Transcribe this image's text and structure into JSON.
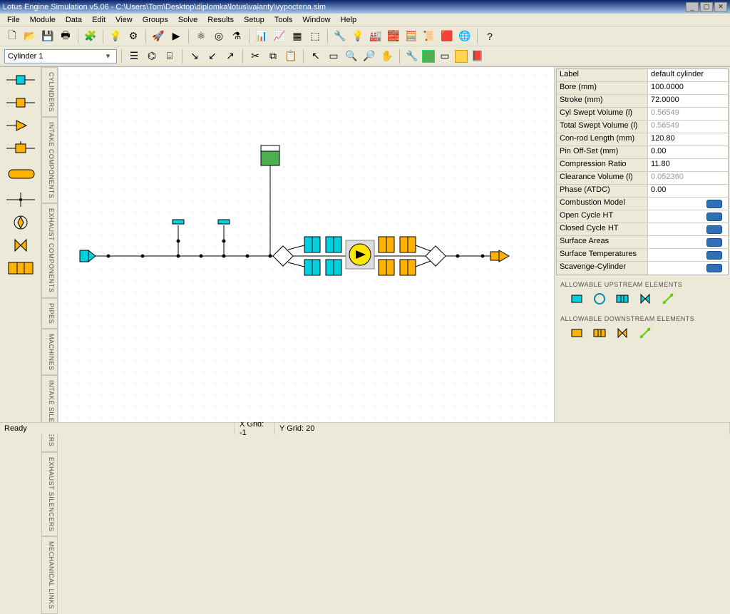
{
  "window": {
    "title": "Lotus Engine Simulation v5.06 - C:\\Users\\Tom\\Desktop\\diplomka\\lotus\\vaianty\\vypoctena.sim"
  },
  "menu": [
    "File",
    "Module",
    "Data",
    "Edit",
    "View",
    "Groups",
    "Solve",
    "Results",
    "Setup",
    "Tools",
    "Window",
    "Help"
  ],
  "combo": {
    "selected": "Cylinder 1"
  },
  "side_tabs": [
    "CYLINDERS",
    "INTAKE COMPONENTS",
    "EXHAUST COMPONENTS",
    "PIPES",
    "MACHINES",
    "INTAKE SILENCERS",
    "EXHAUST SILENCERS",
    "MECHANICAL LINKS"
  ],
  "status": {
    "ready": "Ready",
    "xgrid": "X Grid: -1",
    "ygrid": "Y Grid: 20"
  },
  "props": [
    {
      "label": "Label",
      "value": "default cylinder",
      "kind": "text"
    },
    {
      "label": "Bore (mm)",
      "value": "100.0000",
      "kind": "text"
    },
    {
      "label": "Stroke (mm)",
      "value": "72.0000",
      "kind": "text"
    },
    {
      "label": "Cyl Swept Volume (l)",
      "value": "0.56549",
      "kind": "ro"
    },
    {
      "label": "Total Swept Volume (l)",
      "value": "0.56549",
      "kind": "ro"
    },
    {
      "label": "Con-rod Length (mm)",
      "value": "120.80",
      "kind": "text"
    },
    {
      "label": "Pin Off-Set (mm)",
      "value": "0.00",
      "kind": "text"
    },
    {
      "label": "Compression Ratio",
      "value": "11.80",
      "kind": "text"
    },
    {
      "label": "Clearance Volume (l)",
      "value": "0.052360",
      "kind": "ro"
    },
    {
      "label": "Phase (ATDC)",
      "value": "0.00",
      "kind": "text"
    },
    {
      "label": "Combustion Model",
      "kind": "btn"
    },
    {
      "label": "Open Cycle HT",
      "kind": "btn"
    },
    {
      "label": "Closed Cycle HT",
      "kind": "btn"
    },
    {
      "label": "Surface Areas",
      "kind": "btn"
    },
    {
      "label": "Surface Temperatures",
      "kind": "btn"
    },
    {
      "label": "Scavenge-Cylinder",
      "kind": "btn"
    }
  ],
  "allow": {
    "upstream_label": "ALLOWABLE UPSTREAM ELEMENTS",
    "downstream_label": "ALLOWABLE DOWNSTREAM ELEMENTS"
  }
}
